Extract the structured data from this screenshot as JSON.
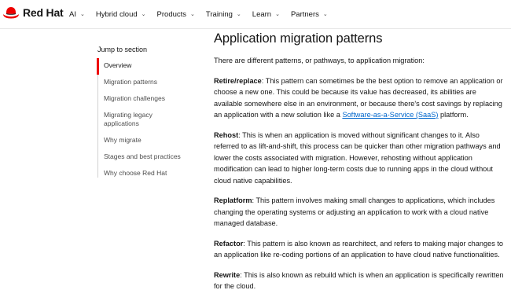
{
  "brand": {
    "name": "Red Hat",
    "accent": "#ee0000"
  },
  "nav": {
    "items": [
      {
        "label": "AI"
      },
      {
        "label": "Hybrid cloud"
      },
      {
        "label": "Products"
      },
      {
        "label": "Training"
      },
      {
        "label": "Learn"
      },
      {
        "label": "Partners"
      }
    ]
  },
  "sidebar": {
    "title": "Jump to section",
    "items": [
      {
        "label": "Overview"
      },
      {
        "label": "Migration patterns"
      },
      {
        "label": "Migration challenges"
      },
      {
        "label": "Migrating legacy applications"
      },
      {
        "label": "Why migrate"
      },
      {
        "label": "Stages and best practices"
      },
      {
        "label": "Why choose Red Hat"
      }
    ]
  },
  "main": {
    "title": "Application migration patterns",
    "intro": "There are different patterns, or pathways, to application migration:",
    "patterns": [
      {
        "term": "Retire/replace",
        "text_before": ": This pattern can sometimes be the best option to remove an application or choose a new one. This could be because its value has decreased, its abilities are available somewhere else in an environment, or because there's cost savings by replacing an application with a new solution like a ",
        "link": "Software-as-a-Service (SaaS)",
        "text_after": " platform."
      },
      {
        "term": "Rehost",
        "text": ":  This is when an application is moved without significant changes to it. Also referred to as lift-and-shift, this process can be quicker than other migration pathways and lower the costs associated with migration. However, rehosting without application modification can lead to higher long-term costs due to running apps in the cloud without cloud native capabilities."
      },
      {
        "term": "Replatform",
        "text": ": This pattern involves making small changes to applications, which includes changing the operating systems or adjusting an application to work with a cloud native managed database."
      },
      {
        "term": "Refactor",
        "text": ": This pattern is also known as rearchitect, and refers to making major changes to an application like re-coding portions of an application to have cloud native functionalities."
      },
      {
        "term": "Rewrite",
        "text": ": This is also known as rebuild which is when an application is specifically rewritten for the cloud."
      }
    ]
  }
}
